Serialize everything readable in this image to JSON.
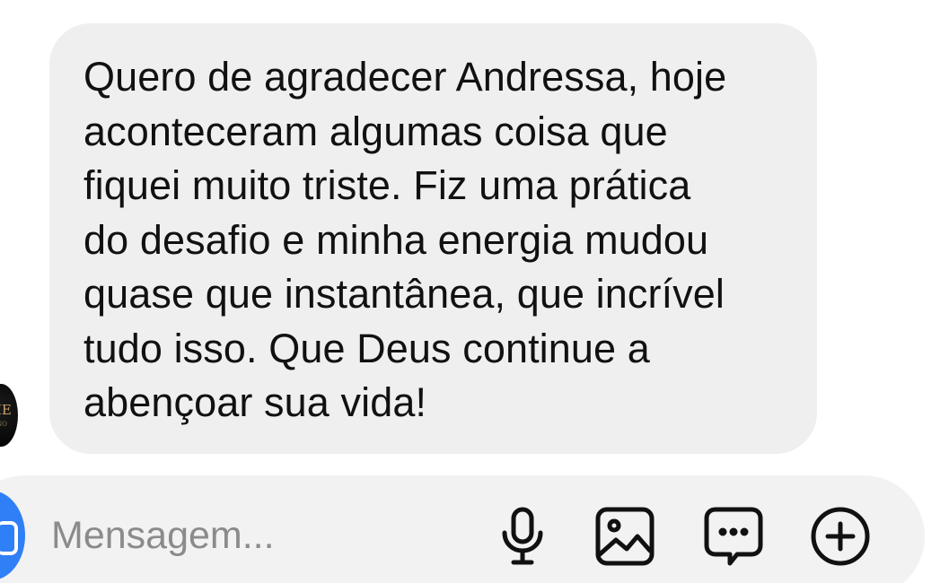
{
  "message": {
    "text": "Quero de agradecer Andressa, hoje\naconteceram algumas coisa que\nfiquei muito triste. Fiz uma prática\ndo desafio e minha energia mudou\nquase que instantânea, que incrível\ntudo isso. Que Deus continue a\nabençoar sua vida!"
  },
  "avatar": {
    "mark": "IE",
    "mark_small": "NO"
  },
  "composer": {
    "placeholder": "Mensagem...",
    "icons": [
      "camera-icon",
      "microphone-icon",
      "photo-gallery-icon",
      "sticker-chat-icon",
      "plus-icon"
    ]
  },
  "colors": {
    "bubble_bg": "#efefef",
    "composer_bg": "#f2f2f2",
    "accent_blue": "#2f7ff6",
    "placeholder_text": "#8b8b8b",
    "icon_stroke": "#111111"
  }
}
